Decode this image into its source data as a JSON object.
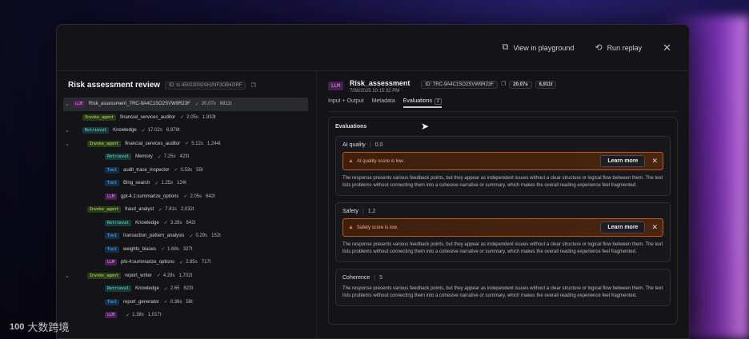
{
  "topbar": {
    "playground_label": "View in playground",
    "replay_label": "Run replay"
  },
  "left": {
    "title": "Risk assessment review",
    "id_chip": "ID: tc-450230S0SH2NF2OB42IRF"
  },
  "tree": [
    {
      "tag": "LLM",
      "type": "llm",
      "name": "Risk_assessment_TRC-9A4C1SO2SVW9R23F",
      "time": "20.07s",
      "tokens": "6911t",
      "level": 0,
      "selected": true
    },
    {
      "tag": "Invoke_agent",
      "type": "agent",
      "name": "financial_services_auditor",
      "time": "2.05s",
      "tokens": "1,933t",
      "level": 1
    },
    {
      "tag": "Retrieval",
      "type": "retrieval",
      "name": "Knowledge",
      "time": "17.02s",
      "tokens": "6,978t",
      "level": 1
    },
    {
      "tag": "Invoke_agent",
      "type": "agent",
      "name": "financial_services_auditor",
      "time": "5.12s",
      "tokens": "1,244t",
      "level": 2
    },
    {
      "tag": "Retrieval",
      "type": "retrieval",
      "name": "Memory",
      "time": "7.25s",
      "tokens": "423t",
      "level": 3
    },
    {
      "tag": "Tool",
      "type": "tool",
      "name": "audit_trace_inspector",
      "time": "0.53s",
      "tokens": "55t",
      "level": 3
    },
    {
      "tag": "Tool",
      "type": "tool",
      "name": "Bing_search",
      "time": "1.25s",
      "tokens": "124t",
      "level": 3
    },
    {
      "tag": "LLM",
      "type": "llm",
      "name": "gpt-4.1:summarize_options",
      "time": "2.05s",
      "tokens": "642t",
      "level": 3
    },
    {
      "tag": "Invoke_agent",
      "type": "agent",
      "name": "fraud_analyst",
      "time": "7.81s",
      "tokens": "2,032t",
      "level": 2
    },
    {
      "tag": "Retrieval",
      "type": "retrieval",
      "name": "Knowledge",
      "time": "3.28s",
      "tokens": "642t",
      "level": 3
    },
    {
      "tag": "Tool",
      "type": "tool",
      "name": "transaction_pattern_analysis",
      "time": "0.29s",
      "tokens": "152t",
      "level": 3
    },
    {
      "tag": "Tool",
      "type": "tool",
      "name": "weights_biases",
      "time": "1.68s",
      "tokens": "327t",
      "level": 3
    },
    {
      "tag": "LLM",
      "type": "llm",
      "name": "phi-4:summarize_options",
      "time": "2.85s",
      "tokens": "717t",
      "level": 3
    },
    {
      "tag": "Invoke_agent",
      "type": "agent",
      "name": "report_writer",
      "time": "4.28s",
      "tokens": "1,702t",
      "level": 2
    },
    {
      "tag": "Retrieval",
      "type": "retrieval",
      "name": "Knowledge",
      "time": "2.65",
      "tokens": "623t",
      "level": 3
    },
    {
      "tag": "Tool",
      "type": "tool",
      "name": "report_generator",
      "time": "0.36s",
      "tokens": "58t",
      "level": 3
    },
    {
      "tag": "LLM",
      "type": "llm",
      "name": "",
      "time": "1.38s",
      "tokens": "1,017t",
      "level": 3
    }
  ],
  "right": {
    "badge": "LLM",
    "title": "Risk_assessment",
    "date": "7/08/2025 10:15:32 PM",
    "id_chip": "ID: TRC-9A4C1SO2SVW9R23F",
    "time_chip": "20.07s",
    "tokens_chip": "6,911t",
    "tabs": [
      "Input + Output",
      "Metadata",
      "Evaluations"
    ],
    "eval_count": "2",
    "evaluations_heading": "Evaluations"
  },
  "evaluations": [
    {
      "name": "AI quality",
      "score": "0.0",
      "alert": "AI quality score is low.",
      "learn": "Learn more",
      "description": "The response presents various feedback points, but they appear as independent issues without a clear structure or logical flow between them. The text lists problems without connecting them into a cohesive narrative or summary, which makes the overall reading experience feel fragmented."
    },
    {
      "name": "Safety",
      "score": "1.2",
      "alert": "Safety score is low.",
      "learn": "Learn more",
      "description": "The response presents various feedback points, but they appear as independent issues without a clear structure or logical flow between them. The text lists problems without connecting them into a cohesive narrative or summary, which makes the overall reading experience feel fragmented."
    },
    {
      "name": "Coherence",
      "score": "5",
      "description": "The response presents various feedback points, but they appear as independent issues without a clear structure or logical flow between them. The text lists problems without connecting them into a cohesive narrative or summary, which makes the overall reading experience feel fragmented."
    }
  ],
  "watermark": {
    "logo": "100",
    "text": "大数跨境"
  }
}
